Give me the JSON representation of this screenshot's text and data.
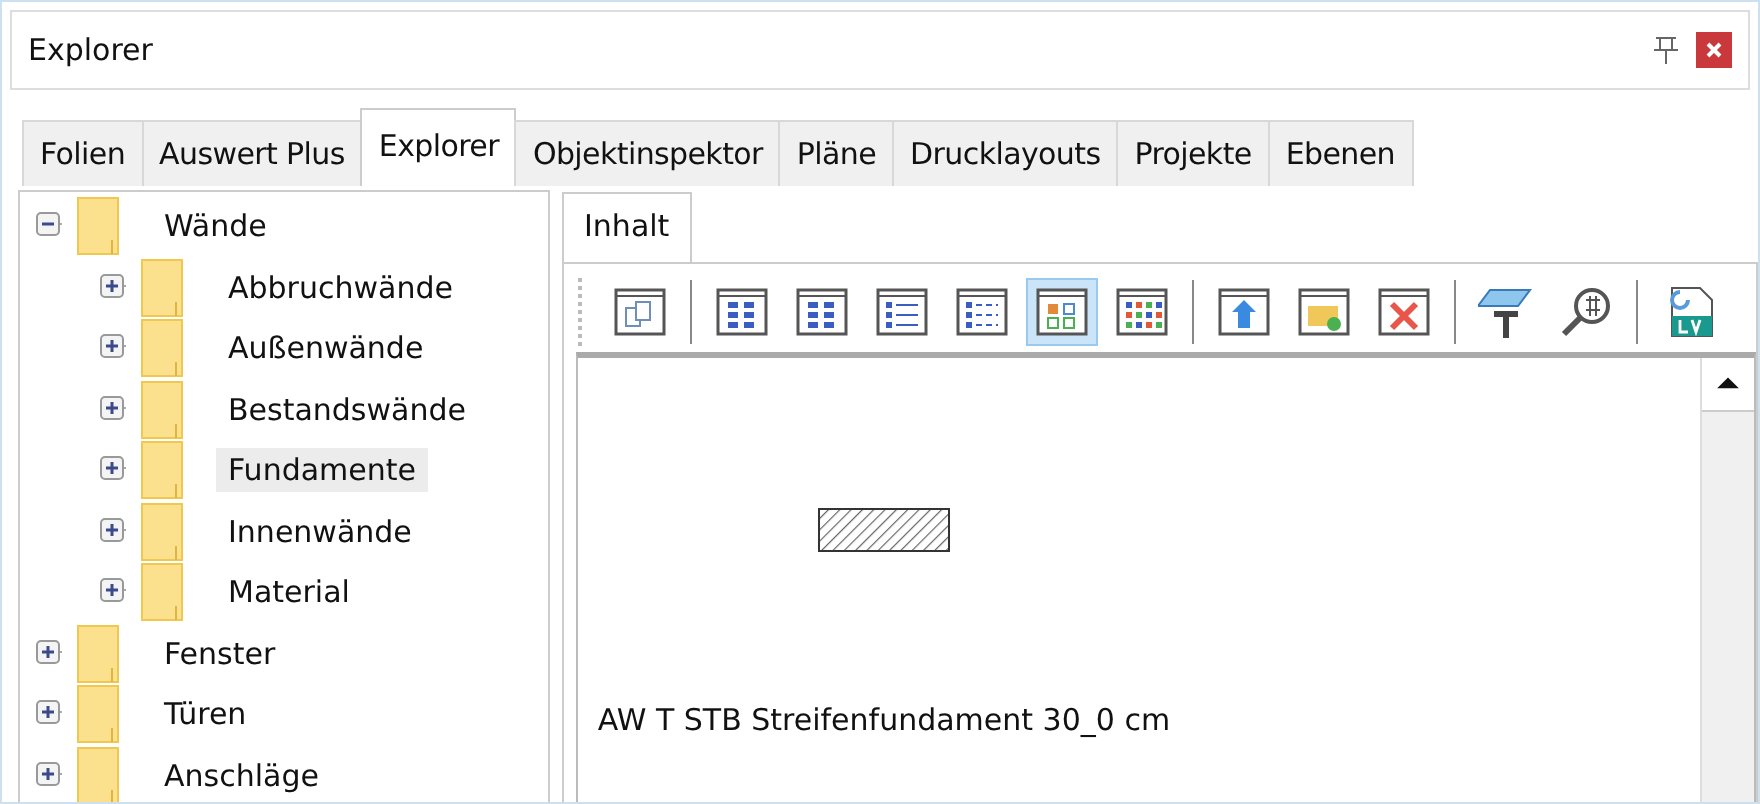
{
  "window": {
    "title": "Explorer"
  },
  "tabs": [
    {
      "label": "Folien",
      "selected": false
    },
    {
      "label": "Auswert Plus",
      "selected": false
    },
    {
      "label": "Explorer",
      "selected": true
    },
    {
      "label": "Objektinspektor",
      "selected": false
    },
    {
      "label": "Pläne",
      "selected": false
    },
    {
      "label": "Drucklayouts",
      "selected": false
    },
    {
      "label": "Projekte",
      "selected": false
    },
    {
      "label": "Ebenen",
      "selected": false
    }
  ],
  "tree": [
    {
      "label": "Wände",
      "expanded": true,
      "selected": false,
      "children": [
        {
          "label": "Abbruchwände",
          "expanded": false,
          "selected": false
        },
        {
          "label": "Außenwände",
          "expanded": false,
          "selected": false
        },
        {
          "label": "Bestandswände",
          "expanded": false,
          "selected": false
        },
        {
          "label": "Fundamente",
          "expanded": false,
          "selected": true
        },
        {
          "label": "Innenwände",
          "expanded": false,
          "selected": false
        },
        {
          "label": "Material",
          "expanded": false,
          "selected": false
        }
      ]
    },
    {
      "label": "Fenster",
      "expanded": false,
      "selected": false
    },
    {
      "label": "Türen",
      "expanded": false,
      "selected": false
    },
    {
      "label": "Anschläge",
      "expanded": false,
      "selected": false
    }
  ],
  "content_tab": {
    "label": "Inhalt"
  },
  "toolbar": [
    [
      {
        "kind": "windows",
        "selected": false
      }
    ],
    [
      {
        "kind": "grid-small",
        "selected": false
      },
      {
        "kind": "grid-medium",
        "selected": false
      },
      {
        "kind": "list",
        "selected": false
      },
      {
        "kind": "details",
        "selected": false
      },
      {
        "kind": "thumbs",
        "selected": true
      },
      {
        "kind": "color-grid",
        "selected": false
      }
    ],
    [
      {
        "kind": "up",
        "selected": false
      },
      {
        "kind": "new-folder",
        "selected": false
      },
      {
        "kind": "delete",
        "selected": false
      }
    ],
    [
      {
        "kind": "text-plane",
        "selected": false
      },
      {
        "kind": "find",
        "selected": false
      }
    ],
    [
      {
        "kind": "lv",
        "selected": false
      }
    ]
  ],
  "item": {
    "caption": "AW T STB Streifenfundament 30_0 cm"
  }
}
